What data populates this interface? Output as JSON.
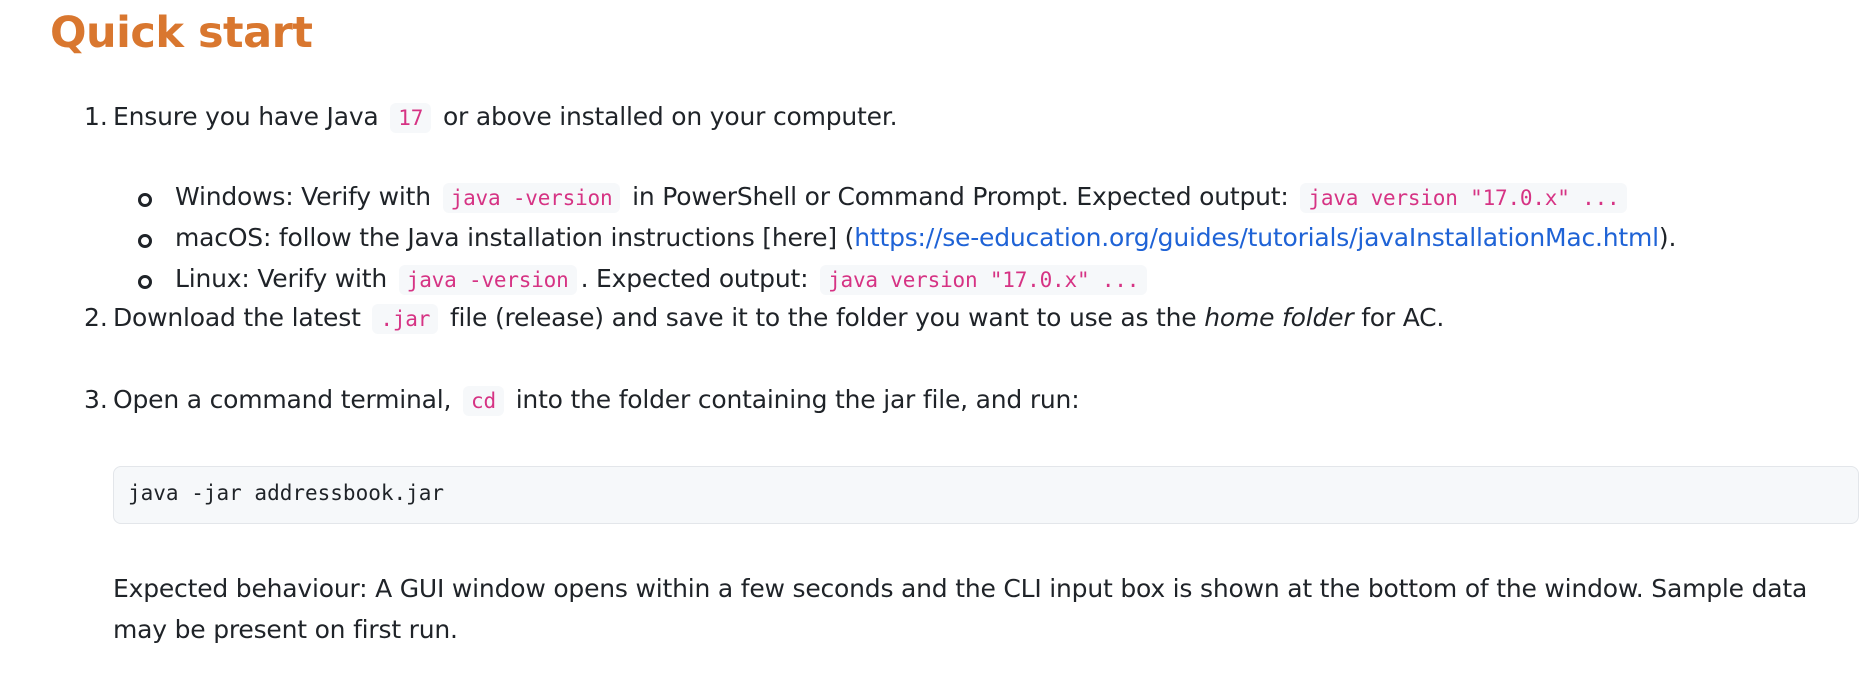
{
  "title": "Quick start",
  "steps": [
    {
      "number": "1.",
      "text_a": "Ensure you have Java",
      "code": "17",
      "text_b": "or above installed on your computer.",
      "subitems": [
        {
          "text_a": "Windows: Verify with",
          "code_a": "java -version",
          "text_b": "in PowerShell or Command Prompt. Expected output:",
          "code_b": "java version \"17.0.x\" ..."
        },
        {
          "text_a": "macOS: follow the Java installation instructions [here] (",
          "link": "https://se-education.org/guides/tutorials/javaInstallationMac.html",
          "text_b": ")."
        },
        {
          "text_a": "Linux: Verify with",
          "code_a": "java -version",
          "text_b": ". Expected output:",
          "code_b": "java version \"17.0.x\" ..."
        }
      ]
    },
    {
      "number": "2.",
      "text_a": "Download the latest",
      "code": ".jar",
      "text_b": "file (release) and save it to the folder you want to use as the",
      "emphasis": "home folder",
      "text_c": "for AC."
    },
    {
      "number": "3.",
      "text_a": "Open a command terminal,",
      "code": "cd",
      "text_b": "into the folder containing the jar file, and run:",
      "code_block": "java -jar addressbook.jar",
      "note": "Expected behaviour: A GUI window opens within a few seconds and the CLI input box is shown at the bottom of the window. Sample data may be present on first run."
    }
  ]
}
